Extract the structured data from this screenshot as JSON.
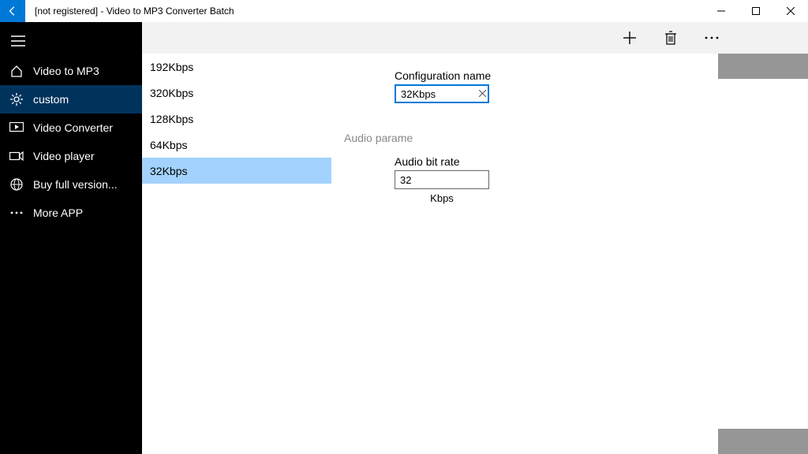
{
  "titlebar": {
    "title": "[not registered] - Video to MP3 Converter Batch"
  },
  "sidebar": {
    "items": [
      {
        "icon": "home-icon",
        "label": "Video to MP3"
      },
      {
        "icon": "gear-icon",
        "label": "custom"
      },
      {
        "icon": "display-icon",
        "label": "Video Converter"
      },
      {
        "icon": "camera-icon",
        "label": "Video player"
      },
      {
        "icon": "globe-icon",
        "label": "Buy full version..."
      },
      {
        "icon": "dots-icon",
        "label": "More APP"
      }
    ],
    "selectedIndex": 1
  },
  "presets": {
    "items": [
      "192Kbps",
      "320Kbps",
      "128Kbps",
      "64Kbps",
      "32Kbps"
    ],
    "selectedIndex": 4
  },
  "form": {
    "configLabel": "Configuration name",
    "configValue": "32Kbps",
    "sectionHead": "Audio parame",
    "bitrateLabel": "Audio bit rate",
    "bitrateValue": "32",
    "bitrateUnit": "Kbps"
  }
}
